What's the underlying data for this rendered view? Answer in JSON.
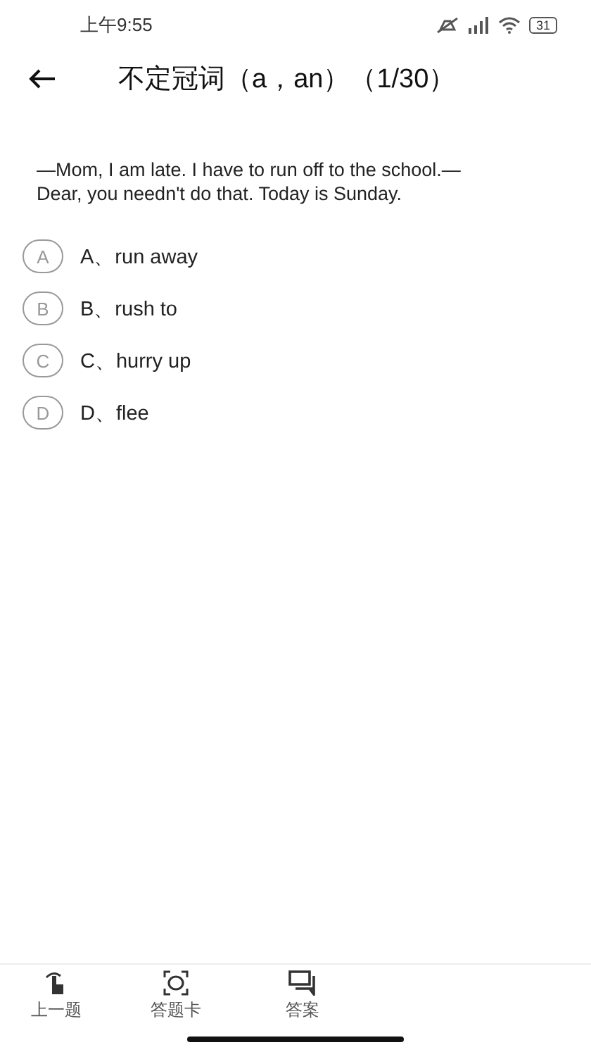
{
  "status_bar": {
    "time": "上午9:55",
    "battery": "31"
  },
  "header": {
    "title": "不定冠词（a，an）（1/30）"
  },
  "question": {
    "text": "—Mom, I am late. I have to run off to the school.—\nDear, you needn't do that. Today is Sunday."
  },
  "options": [
    {
      "letter": "A",
      "text": "A、run away",
      "selected": false
    },
    {
      "letter": "B",
      "text": "B、rush to",
      "selected": false
    },
    {
      "letter": "C",
      "text": "C、hurry up",
      "selected": false
    },
    {
      "letter": "D",
      "text": "D、flee",
      "selected": false
    }
  ],
  "bottom_nav": [
    {
      "kind": "previous",
      "label": "上一题"
    },
    {
      "kind": "card",
      "label": "答题卡"
    },
    {
      "kind": "answer",
      "label": "答案"
    }
  ]
}
